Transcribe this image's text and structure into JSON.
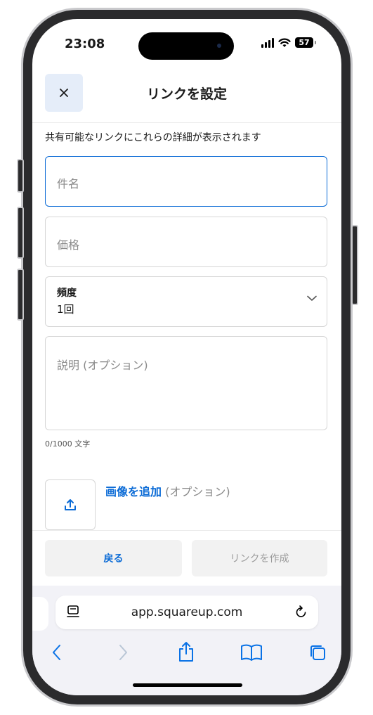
{
  "status_bar": {
    "time": "23:08",
    "battery": "57"
  },
  "header": {
    "title": "リンクを設定",
    "close_icon": "close-icon"
  },
  "subtitle": "共有可能なリンクにこれらの詳細が表示されます",
  "form": {
    "name_placeholder": "件名",
    "price_placeholder": "価格",
    "frequency": {
      "label": "頻度",
      "value": "1回"
    },
    "description_placeholder": "説明 (オプション)",
    "char_counter": "0/1000 文字",
    "add_image": {
      "link": "画像を追加",
      "optional": " (オプション)"
    }
  },
  "actions": {
    "back": "戻る",
    "create": "リンクを作成"
  },
  "browser": {
    "url": "app.squareup.com"
  },
  "colors": {
    "accent": "#0b6bd6",
    "close_bg": "#e5edf9",
    "button_bg": "#f2f2f2"
  }
}
